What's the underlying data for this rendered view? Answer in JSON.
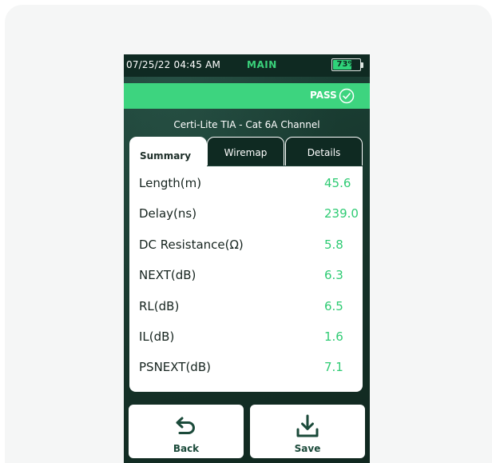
{
  "status_bar": {
    "datetime": "07/25/22 04:45 AM",
    "mode": "MAIN",
    "battery_percent": "73%",
    "battery_level": 0.73
  },
  "result": {
    "status": "PASS"
  },
  "test": {
    "title": "Certi-Lite TIA - Cat 6A Channel"
  },
  "tabs": [
    {
      "label": "Summary",
      "active": true
    },
    {
      "label": "Wiremap",
      "active": false
    },
    {
      "label": "Details",
      "active": false
    }
  ],
  "measurements": [
    {
      "label": "Length(m)",
      "value": "45.6"
    },
    {
      "label": "Delay(ns)",
      "value": "239.0"
    },
    {
      "label": "DC Resistance(Ω)",
      "value": "5.8"
    },
    {
      "label": "NEXT(dB)",
      "value": "6.3"
    },
    {
      "label": "RL(dB)",
      "value": "6.5"
    },
    {
      "label": "IL(dB)",
      "value": "1.6"
    },
    {
      "label": "PSNEXT(dB)",
      "value": "7.1"
    }
  ],
  "buttons": {
    "back_label": "Back",
    "back_icon": "undo-arrow-icon",
    "save_label": "Save",
    "save_icon": "download-icon"
  },
  "colors": {
    "accent_green": "#3dd47f",
    "value_green": "#2ecb73",
    "device_dark": "#1a3d34"
  }
}
